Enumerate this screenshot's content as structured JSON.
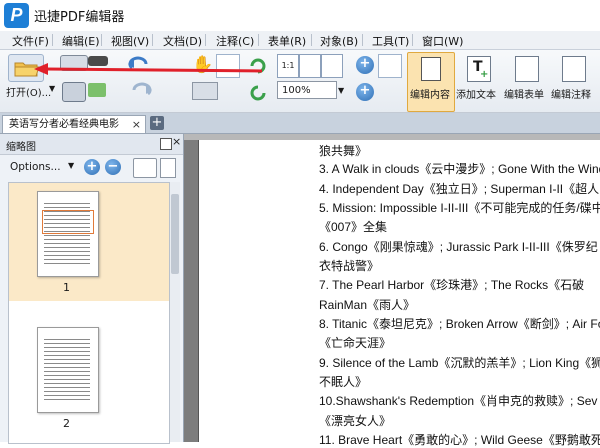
{
  "app": {
    "logo_letter": "P",
    "title": "迅捷PDF编辑器"
  },
  "menu": [
    {
      "label": "文件(F)"
    },
    {
      "label": "编辑(E)"
    },
    {
      "label": "视图(V)"
    },
    {
      "label": "文档(D)"
    },
    {
      "label": "注释(C)"
    },
    {
      "label": "表单(R)"
    },
    {
      "label": "对象(B)"
    },
    {
      "label": "工具(T)"
    },
    {
      "label": "窗口(W)"
    }
  ],
  "toolbar": {
    "open_label": "打开(O)...",
    "zoom_value": "100%",
    "fit_label": "1:1",
    "edit_content_label": "编辑内容",
    "add_text_label": "添加文本",
    "edit_form_label": "编辑表单",
    "edit_annot_label": "编辑注释"
  },
  "tab": {
    "document_title": "英语写分者必看经典电影",
    "close_glyph": "×",
    "add_glyph": "+"
  },
  "sidebar": {
    "title": "缩略图",
    "close_glyph": "×",
    "options_label": "Options...",
    "zoom_in": "+",
    "zoom_out": "−",
    "thumbnails": [
      {
        "page": "1"
      },
      {
        "page": "2"
      }
    ]
  },
  "document": {
    "lines": [
      "狼共舞》",
      "3. A Walk in clouds《云中漫步》; Gone With the Wind",
      "4. Independent Day《独立日》; Superman I-II《超人",
      "5. Mission: Impossible I-II-III《不可能完成的任务/碟中",
      "《007》全集",
      "6. Congo《刚果惊魂》; Jurassic Park I-II-III《侏罗纪",
      "衣特战警》",
      "7. The Pearl Harbor《珍珠港》; The Rocks《石破",
      "RainMan《雨人》",
      "8. Titanic《泰坦尼克》; Broken Arrow《断剑》; Air Fo",
      "《亡命天涯》",
      "9. Silence of the Lamb《沉默的羔羊》; Lion King《狮",
      "不眠人》",
      "10.Shawshank's Redemption《肖申克的救赎》; Sev",
      "《漂亮女人》",
      "11. Brave Heart《勇敢的心》; Wild Geese《野鹅敢死"
    ]
  },
  "colors": {
    "logo_blue": "#1e7fd6",
    "annotation_red": "#e0202a",
    "thumb_selected": "#fbe9c8"
  }
}
